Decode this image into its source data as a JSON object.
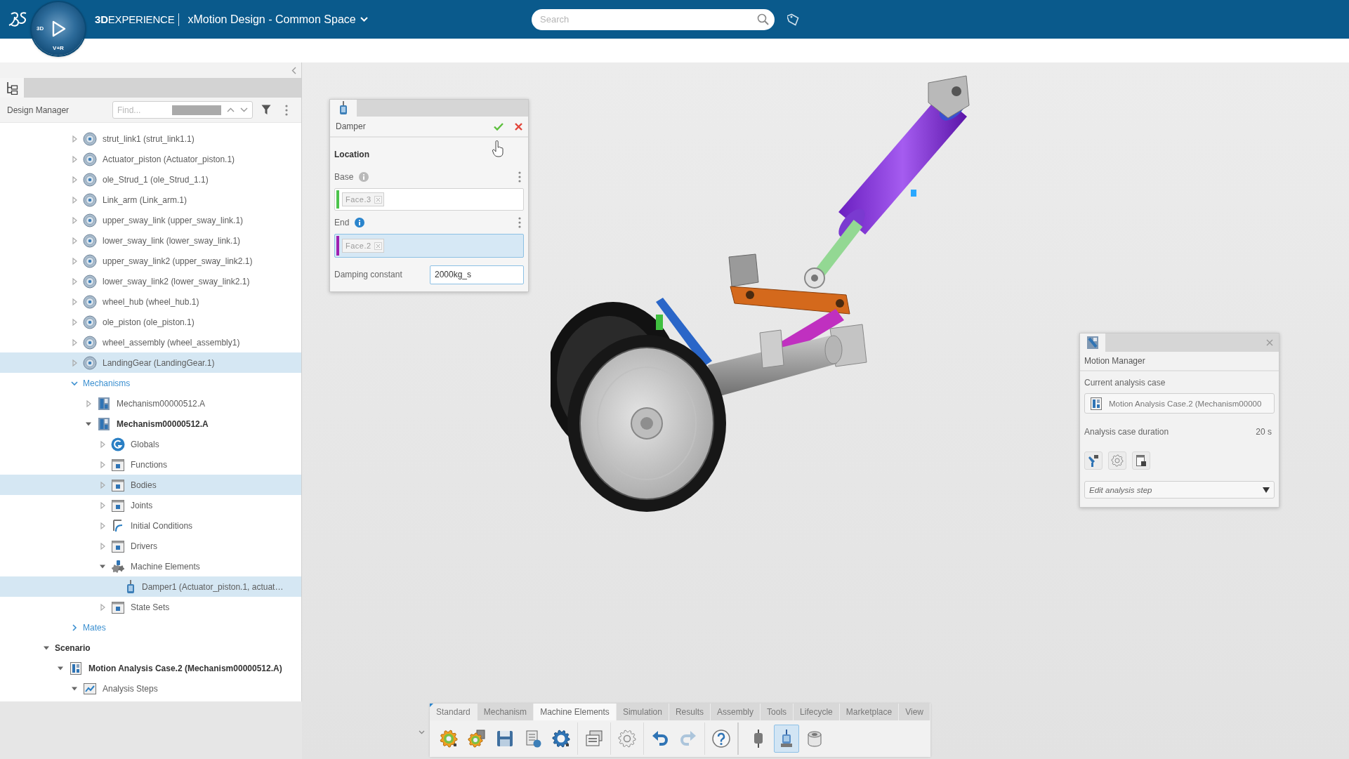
{
  "topbar": {
    "brand": "**3D**EXPERIENCE",
    "space": "xMotion Design - Common Space",
    "search_placeholder": "Search",
    "compass_labels": [
      "3D",
      "V+R"
    ]
  },
  "design_manager": {
    "title": "Design Manager",
    "find_placeholder": "Find...",
    "tree": [
      {
        "children": [
          {
            "children": [
              {
                "kind": "part",
                "label": "strut_link1 (strut_link1.1)",
                "expanded": false,
                "selected": false,
                "active": false
              },
              {
                "kind": "part",
                "label": "Actuator_piston (Actuator_piston.1)",
                "expanded": false,
                "selected": false,
                "active": false
              },
              {
                "kind": "part",
                "label": "ole_Strud_1 (ole_Strud_1.1)",
                "expanded": false,
                "selected": false,
                "active": false
              },
              {
                "kind": "part",
                "label": "Link_arm (Link_arm.1)",
                "expanded": false,
                "selected": false,
                "active": false
              },
              {
                "kind": "part",
                "label": "upper_sway_link (upper_sway_link.1)",
                "expanded": false,
                "selected": false,
                "active": false
              },
              {
                "kind": "part",
                "label": "lower_sway_link (lower_sway_link.1)",
                "expanded": false,
                "selected": false,
                "active": false
              },
              {
                "kind": "part",
                "label": "upper_sway_link2 (upper_sway_link2.1)",
                "expanded": false,
                "selected": false,
                "active": false
              },
              {
                "kind": "part",
                "label": "lower_sway_link2 (lower_sway_link2.1)",
                "expanded": false,
                "selected": false,
                "active": false
              },
              {
                "kind": "part",
                "label": "wheel_hub (wheel_hub.1)",
                "expanded": false,
                "selected": false,
                "active": false
              },
              {
                "kind": "part",
                "label": "ole_piston (ole_piston.1)",
                "expanded": false,
                "selected": false,
                "active": false
              },
              {
                "kind": "part",
                "label": "wheel_assembly (wheel_assembly1)",
                "expanded": false,
                "selected": false,
                "active": false
              },
              {
                "kind": "part",
                "label": "LandingGear (LandingGear.1)",
                "expanded": false,
                "selected": true,
                "active": false
              },
              {
                "kind": "section",
                "label": "Mechanisms",
                "expanded": true,
                "selected": false,
                "active": false,
                "children": [
                  {
                    "kind": "mechanism",
                    "label": "Mechanism00000512.A",
                    "expanded": false,
                    "selected": false,
                    "active": false
                  },
                  {
                    "kind": "mechanism",
                    "label": "Mechanism00000512.A",
                    "expanded": true,
                    "selected": false,
                    "active": true,
                    "children": [
                      {
                        "kind": "globals",
                        "label": "Globals",
                        "expanded": false,
                        "selected": false,
                        "active": false
                      },
                      {
                        "kind": "folder",
                        "label": "Functions",
                        "expanded": false,
                        "selected": false,
                        "active": false
                      },
                      {
                        "kind": "folder",
                        "label": "Bodies",
                        "expanded": false,
                        "selected": true,
                        "active": false
                      },
                      {
                        "kind": "folder",
                        "label": "Joints",
                        "expanded": false,
                        "selected": false,
                        "active": false
                      },
                      {
                        "kind": "conditions",
                        "label": "Initial Conditions",
                        "expanded": false,
                        "selected": false,
                        "active": false
                      },
                      {
                        "kind": "folder",
                        "label": "Drivers",
                        "expanded": false,
                        "selected": false,
                        "active": false
                      },
                      {
                        "kind": "elements",
                        "label": "Machine Elements",
                        "expanded": true,
                        "selected": false,
                        "active": false,
                        "children": [
                          {
                            "kind": "damper",
                            "label": "Damper1 (Actuator_piston.1, actuat…",
                            "selected": true,
                            "active": false
                          }
                        ]
                      },
                      {
                        "kind": "folder",
                        "label": "State Sets",
                        "expanded": false,
                        "selected": false,
                        "active": false
                      }
                    ]
                  }
                ]
              },
              {
                "kind": "section",
                "label": "Mates",
                "expanded": false,
                "selected": false,
                "active": false
              }
            ]
          }
        ]
      },
      {
        "kind": "heading",
        "label": "Scenario",
        "expanded": true,
        "selected": false,
        "active": true,
        "children": [
          {
            "kind": "case",
            "label": "Motion Analysis Case.2 (Mechanism00000512.A)",
            "expanded": true,
            "selected": false,
            "active": true,
            "children": [
              {
                "kind": "steps",
                "label": "Analysis Steps",
                "expanded": true,
                "selected": false,
                "active": false
              }
            ]
          }
        ]
      }
    ]
  },
  "damper": {
    "title": "Damper",
    "section": "Location",
    "selections": [
      {
        "label": "Base",
        "chips": [
          "Face.3"
        ],
        "color": "#4cc44c",
        "selected": false
      },
      {
        "label": "End",
        "chips": [
          "Face.2"
        ],
        "color": "#a01fb0",
        "selected": true
      }
    ],
    "constant_label": "Damping constant",
    "constant_value": "2000kg_s"
  },
  "motion_manager": {
    "title": "Motion Manager",
    "case_label": "Current analysis case",
    "case_value": "Motion Analysis Case.2 (Mechanism00000",
    "duration_label": "Analysis case duration",
    "duration": "20 s",
    "step_prompt": "Edit analysis step"
  },
  "toolbar": {
    "tabs": [
      {
        "label": "Standard",
        "selected": false,
        "pinned": true
      },
      {
        "label": "Mechanism",
        "selected": false,
        "pinned": false
      },
      {
        "label": "Machine Elements",
        "selected": true,
        "pinned": false
      },
      {
        "label": "Simulation",
        "selected": false,
        "pinned": false
      },
      {
        "label": "Results",
        "selected": false,
        "pinned": false
      },
      {
        "label": "Assembly",
        "selected": false,
        "pinned": false
      },
      {
        "label": "Tools",
        "selected": false,
        "pinned": false
      },
      {
        "label": "Lifecycle",
        "selected": false,
        "pinned": false
      },
      {
        "label": "Marketplace",
        "selected": false,
        "pinned": false
      },
      {
        "label": "View",
        "selected": false,
        "pinned": false
      }
    ],
    "groups": [
      {
        "commands": [
          {
            "kind": "solver",
            "selected": false,
            "disabled": false
          },
          {
            "kind": "batch",
            "selected": false,
            "disabled": false
          },
          {
            "kind": "save",
            "selected": false,
            "disabled": false
          },
          {
            "kind": "export",
            "selected": false,
            "disabled": false
          },
          {
            "kind": "update",
            "selected": false,
            "disabled": false
          }
        ]
      },
      {
        "commands": [
          {
            "kind": "properties",
            "selected": false,
            "disabled": false
          }
        ]
      },
      {
        "commands": [
          {
            "kind": "settings",
            "selected": false,
            "disabled": false
          }
        ]
      },
      {
        "commands": [
          {
            "kind": "undo",
            "selected": false,
            "disabled": false
          },
          {
            "kind": "redo",
            "selected": false,
            "disabled": true
          }
        ]
      },
      {
        "commands": [
          {
            "kind": "help",
            "selected": false,
            "disabled": false
          }
        ]
      },
      {
        "commands": [
          {
            "kind": "spring",
            "selected": false,
            "disabled": false
          },
          {
            "kind": "damper",
            "selected": true,
            "disabled": false
          },
          {
            "kind": "bushing",
            "selected": false,
            "disabled": false
          }
        ]
      }
    ]
  }
}
